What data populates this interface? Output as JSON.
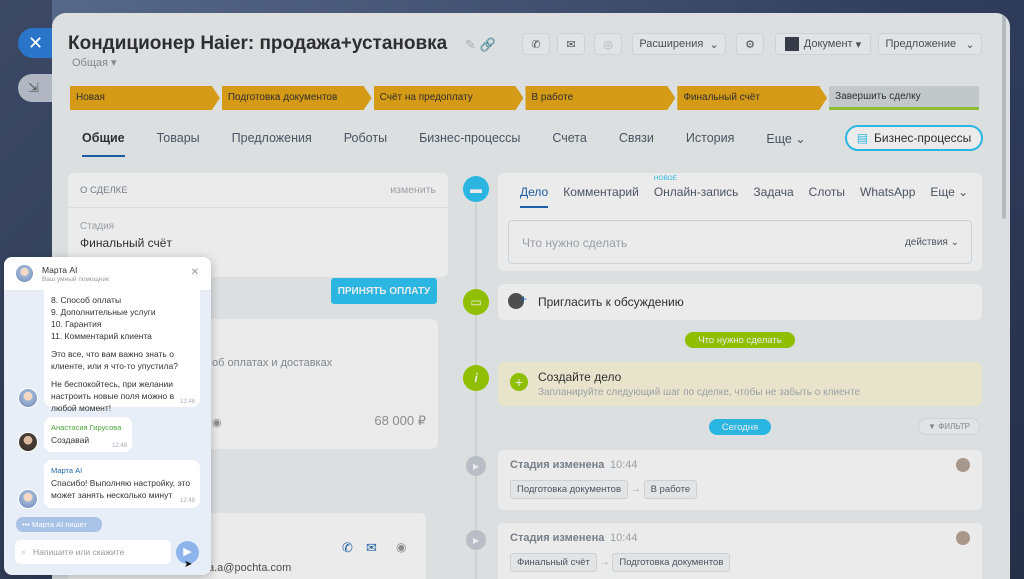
{
  "deal": {
    "title": "Кондиционер Haier: продажа+установка",
    "category": "Общая"
  },
  "toolbar": {
    "extensions_label": "Расширения",
    "document_label": "Документ",
    "proposal_label": "Предложение"
  },
  "stages": [
    {
      "label": "Новая"
    },
    {
      "label": "Подготовка документов"
    },
    {
      "label": "Счёт на предоплату"
    },
    {
      "label": "В работе"
    },
    {
      "label": "Финальный счёт"
    },
    {
      "label": "Завершить сделку"
    }
  ],
  "tabs": [
    {
      "label": "Общие"
    },
    {
      "label": "Товары"
    },
    {
      "label": "Предложения"
    },
    {
      "label": "Роботы"
    },
    {
      "label": "Бизнес-процессы"
    },
    {
      "label": "Счета"
    },
    {
      "label": "Связи"
    },
    {
      "label": "История"
    },
    {
      "label": "Еще"
    }
  ],
  "bp_button": "Бизнес-процессы",
  "about": {
    "header": "О СДЕЛКЕ",
    "edit": "изменить",
    "stage_label": "Стадия",
    "stage_value": "Финальный счёт",
    "accept_payment": "ПРИНЯТЬ ОПЛАТУ",
    "payments_text": "об оплатах и доставках",
    "amount": "68 000 ₽",
    "email_partial": "а.a@pochta.com"
  },
  "activity": {
    "tabs": [
      {
        "label": "Дело"
      },
      {
        "label": "Комментарий"
      },
      {
        "label": "Онлайн-запись"
      },
      {
        "label": "Задача"
      },
      {
        "label": "Слоты"
      },
      {
        "label": "WhatsApp"
      },
      {
        "label": "Еще"
      }
    ],
    "new_badge": "НОВОЕ",
    "placeholder": "Что нужно сделать",
    "actions_label": "действия"
  },
  "timeline": {
    "invite": "Пригласить к обсуждению",
    "todo_pill": "Что нужно сделать",
    "create_title": "Создайте дело",
    "create_sub": "Запланируйте следующий шаг по сделке, чтобы не забыть о клиенте",
    "today_pill": "Сегодня",
    "filter_label": "ФИЛЬТР",
    "events": [
      {
        "title": "Стадия изменена",
        "time": "10:44",
        "from": "Подготовка документов",
        "to": "В работе"
      },
      {
        "title": "Стадия изменена",
        "time": "10:44",
        "from": "Финальный счёт",
        "to": "Подготовка документов"
      }
    ]
  },
  "chat": {
    "name": "Марта AI",
    "subtitle": "Ваш умный помощник",
    "msg1_lines": [
      "8. Способ оплаты",
      "9. Дополнительные услуги",
      "10. Гарантия",
      "11. Комментарий клиента"
    ],
    "msg1_p2": "Это все, что вам важно знать о клиенте, или я что-то упустила?",
    "msg1_p3": "Не беспокойтесь, при желании настроить новые поля можно в любой момент!",
    "msg1_time": "12:48",
    "user_name": "Анастасия Гирусова",
    "user_msg": "Создавай",
    "user_time": "12:48",
    "bot_name": "Марта AI",
    "bot_msg": "Спасибо! Выполняю настройку, это может занять несколько минут",
    "bot_time": "12:48",
    "typing": "Марта AI пишет",
    "input_placeholder": "Напишите или скажите"
  }
}
